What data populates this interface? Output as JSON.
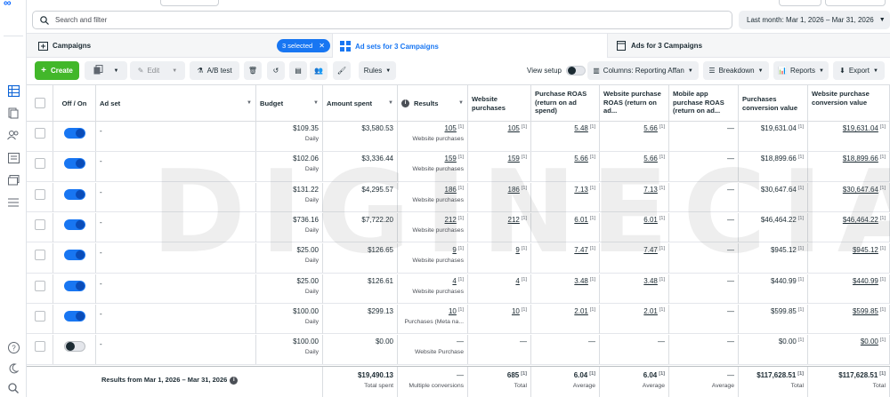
{
  "app": {
    "logo_text": "∞"
  },
  "search": {
    "placeholder": "Search and filter"
  },
  "date_range": {
    "label": "Last month: Mar 1, 2026 – Mar 31, 2026"
  },
  "tabs": {
    "campaigns": "Campaigns",
    "selected_badge": "3 selected",
    "adsets": "Ad sets for 3 Campaigns",
    "ads": "Ads for 3 Campaigns"
  },
  "toolbar": {
    "create": "Create",
    "edit": "Edit",
    "ab_test": "A/B test",
    "rules": "Rules",
    "view_setup": "View setup",
    "columns": "Columns: Reporting Affan",
    "breakdown": "Breakdown",
    "reports": "Reports",
    "export": "Export"
  },
  "columns": {
    "offon": "Off / On",
    "adset": "Ad set",
    "budget": "Budget",
    "amount": "Amount spent",
    "results": "Results",
    "web_purch": "Website purchases",
    "roas": "Purchase ROAS (return on ad spend)",
    "web_roas": "Website purchase ROAS (return on ad...",
    "app_roas": "Mobile app purchase ROAS (return on ad...",
    "conv_value": "Purchases conversion value",
    "web_conv_value": "Website purchase conversion value"
  },
  "rows": [
    {
      "on": true,
      "name": "-",
      "budget": "$109.35",
      "period": "Daily",
      "spent": "$3,580.53",
      "results": "105",
      "rtype": "Website purchases",
      "wp": "105",
      "roas": "5.48",
      "wroas": "5.66",
      "aroas": "—",
      "cv": "$19,631.04",
      "wcv": "$19,631.04"
    },
    {
      "on": true,
      "name": "-",
      "budget": "$102.06",
      "period": "Daily",
      "spent": "$3,336.44",
      "results": "159",
      "rtype": "Website purchases",
      "wp": "159",
      "roas": "5.66",
      "wroas": "5.66",
      "aroas": "—",
      "cv": "$18,899.66",
      "wcv": "$18,899.66"
    },
    {
      "on": true,
      "name": "-",
      "budget": "$131.22",
      "period": "Daily",
      "spent": "$4,295.57",
      "results": "186",
      "rtype": "Website purchases",
      "wp": "186",
      "roas": "7.13",
      "wroas": "7.13",
      "aroas": "—",
      "cv": "$30,647.64",
      "wcv": "$30,647.64"
    },
    {
      "on": true,
      "name": "-",
      "budget": "$736.16",
      "period": "Daily",
      "spent": "$7,722.20",
      "results": "212",
      "rtype": "Website purchases",
      "wp": "212",
      "roas": "6.01",
      "wroas": "6.01",
      "aroas": "—",
      "cv": "$46,464.22",
      "wcv": "$46,464.22"
    },
    {
      "on": true,
      "name": "-",
      "budget": "$25.00",
      "period": "Daily",
      "spent": "$126.65",
      "results": "9",
      "rtype": "Website purchases",
      "wp": "9",
      "roas": "7.47",
      "wroas": "7.47",
      "aroas": "—",
      "cv": "$945.12",
      "wcv": "$945.12"
    },
    {
      "on": true,
      "name": "-",
      "budget": "$25.00",
      "period": "Daily",
      "spent": "$126.61",
      "results": "4",
      "rtype": "Website purchases",
      "wp": "4",
      "roas": "3.48",
      "wroas": "3.48",
      "aroas": "—",
      "cv": "$440.99",
      "wcv": "$440.99"
    },
    {
      "on": true,
      "name": "-",
      "budget": "$100.00",
      "period": "Daily",
      "spent": "$299.13",
      "results": "10",
      "rtype": "Purchases (Meta na...",
      "wp": "10",
      "roas": "2.01",
      "wroas": "2.01",
      "aroas": "—",
      "cv": "$599.85",
      "wcv": "$599.85"
    },
    {
      "on": false,
      "name": "-",
      "budget": "$100.00",
      "period": "Daily",
      "spent": "$0.00",
      "results": "—",
      "rtype": "Website Purchase",
      "wp": "—",
      "roas": "—",
      "wroas": "—",
      "aroas": "—",
      "cv": "$0.00",
      "wcv": "$0.00"
    }
  ],
  "footnote_marker": "[1]",
  "totals": {
    "label": "Results from Mar 1, 2026 – Mar 31, 2026",
    "spent": "$19,490.13",
    "spent_sub": "Total spent",
    "results": "—",
    "results_sub": "Multiple conversions",
    "wp": "685",
    "wp_sub": "Total",
    "roas": "6.04",
    "roas_sub": "Average",
    "wroas": "6.04",
    "wroas_sub": "Average",
    "aroas": "—",
    "aroas_sub": "Average",
    "cv": "$117,628.51",
    "cv_sub": "Total",
    "wcv": "$117,628.51",
    "wcv_sub": "Total"
  },
  "watermark": "DIGINECIA",
  "colors": {
    "accent": "#1876f2",
    "create_green": "#42b72a"
  }
}
